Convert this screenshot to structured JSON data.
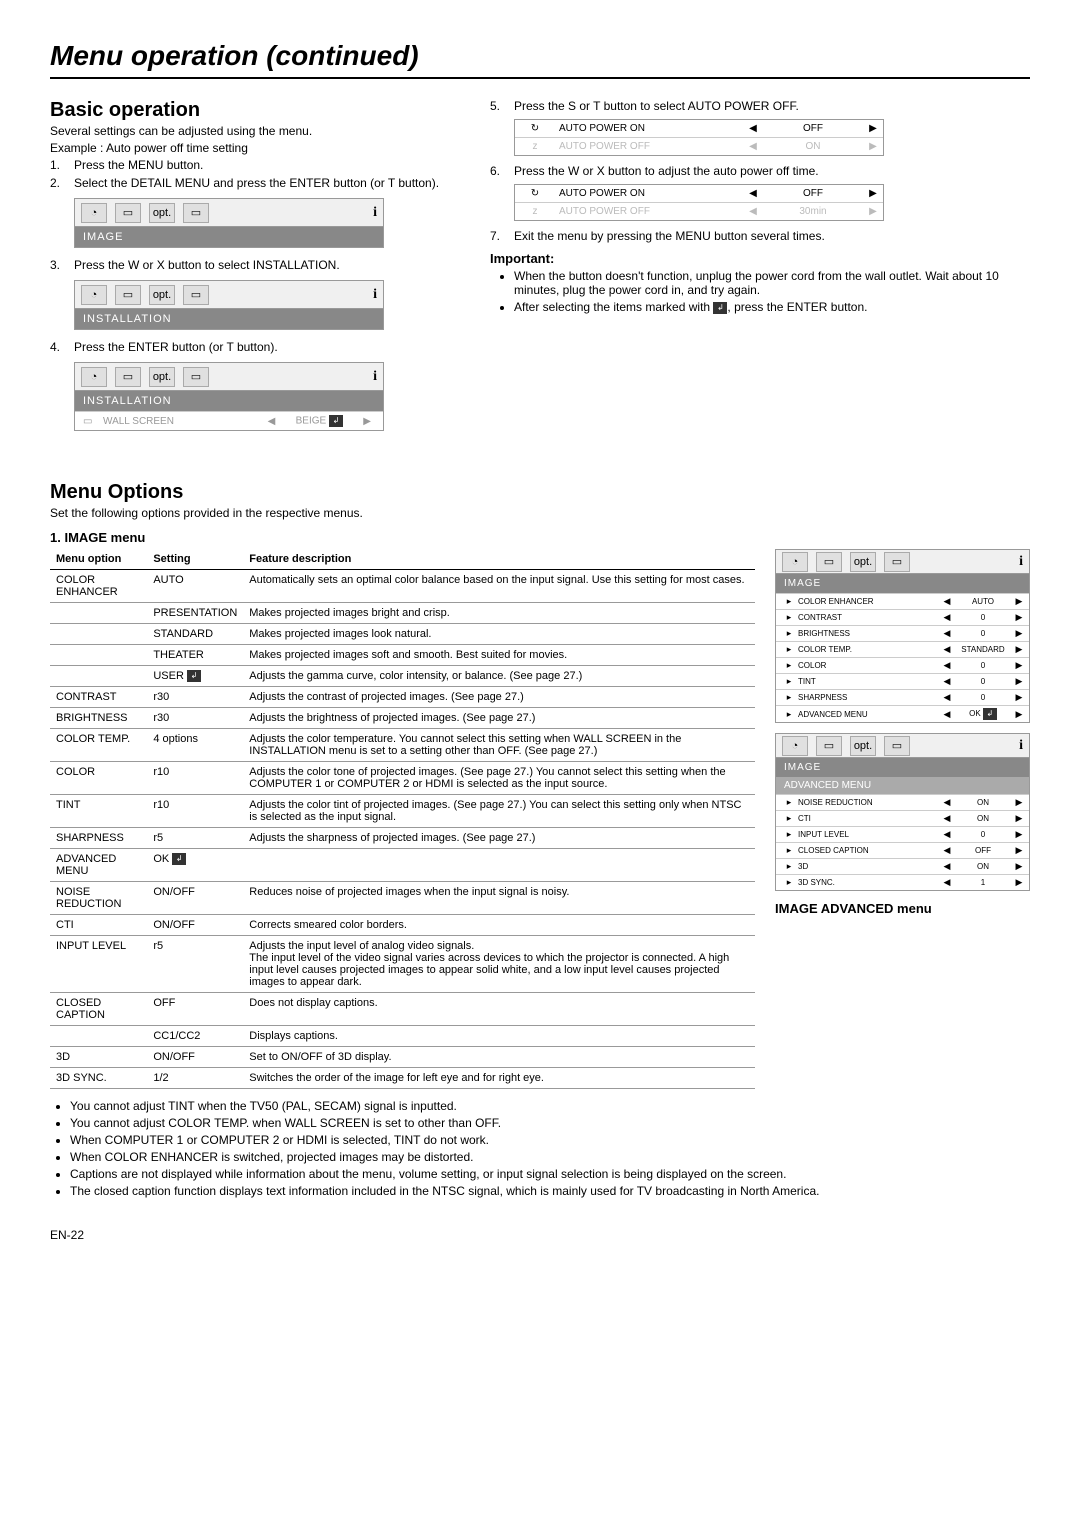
{
  "page_title": "Menu operation (continued)",
  "basic": {
    "heading": "Basic operation",
    "intro1": "Several settings can be adjusted using the menu.",
    "intro2": "Example : Auto power off time setting",
    "s1": "Press the MENU button.",
    "s2": "Select the DETAIL MENU and press the ENTER button  (or  T  button).",
    "s3": "Press the  W or  X button to select INSTALLATION.",
    "s4": "Press the ENTER button (or  T  button).",
    "img_label": "IMAGE",
    "inst_label": "INSTALLATION",
    "wall_screen": "WALL SCREEN",
    "beige": "BEIGE"
  },
  "right": {
    "s5": "Press the  S  or  T  button to select AUTO POWER OFF.",
    "s6": "Press the  W or  X button to adjust the auto power off time.",
    "s7": "Exit the menu by pressing the MENU button several times.",
    "ap_on": "AUTO POWER ON",
    "ap_off": "AUTO POWER OFF",
    "off": "OFF",
    "on": "ON",
    "thirty": "30min",
    "important": "Important:",
    "b1": "When the button doesn't function, unplug the power cord from the wall outlet. Wait about 10 minutes, plug the power cord in, and try again.",
    "b2_a": "After selecting the items marked with ",
    "b2_b": ", press the ENTER button."
  },
  "menu_options": {
    "heading": "Menu Options",
    "intro": "Set the following options provided in the respective menus.",
    "image_menu": "1. IMAGE menu",
    "th1": "Menu option",
    "th2": "Setting",
    "th3": "Feature description",
    "rows": [
      {
        "o": "COLOR ENHANCER",
        "s": "AUTO",
        "d": "Automatically sets an optimal color balance based on the input signal. Use this setting for most cases."
      },
      {
        "o": "",
        "s": "PRESENTATION",
        "d": "Makes projected images bright and crisp."
      },
      {
        "o": "",
        "s": "STANDARD",
        "d": "Makes projected images look natural."
      },
      {
        "o": "",
        "s": "THEATER",
        "d": "Makes projected images soft and smooth. Best suited for movies."
      },
      {
        "o": "",
        "s": "USER",
        "d": "Adjusts the gamma curve, color intensity, or balance. (See page 27.)"
      },
      {
        "o": "CONTRAST",
        "s": "r30",
        "d": "Adjusts the contrast of projected images. (See page 27.)"
      },
      {
        "o": "BRIGHTNESS",
        "s": "r30",
        "d": "Adjusts the brightness of projected images. (See page 27.)"
      },
      {
        "o": "COLOR TEMP.",
        "s": "4 options",
        "d": "Adjusts the color temperature. You cannot select this setting when WALL SCREEN in the INSTALLATION menu is set to a setting other than OFF. (See page 27.)"
      },
      {
        "o": "COLOR",
        "s": "r10",
        "d": "Adjusts the color tone of projected images. (See page 27.) You cannot select this setting when the COMPUTER 1 or COMPUTER 2 or HDMI is selected as the input source."
      },
      {
        "o": "TINT",
        "s": "r10",
        "d": "Adjusts the color tint of projected images. (See page 27.) You can select this setting only when NTSC is selected as the input signal."
      },
      {
        "o": "SHARPNESS",
        "s": "r5",
        "d": "Adjusts the sharpness of projected images. (See page 27.)"
      },
      {
        "o": "ADVANCED MENU",
        "s": "OK",
        "d": ""
      },
      {
        "o": "     NOISE REDUCTION",
        "s": "ON/OFF",
        "d": "Reduces noise of projected images when the input signal is noisy."
      },
      {
        "o": "     CTI",
        "s": "ON/OFF",
        "d": "Corrects smeared color borders."
      },
      {
        "o": "     INPUT LEVEL",
        "s": "r5",
        "d": "Adjusts the input level of analog video signals.\nThe input level of the video signal varies across devices to which the projector is connected. A high input level causes projected images to appear solid white, and a low input level causes projected images to appear dark."
      },
      {
        "o": "     CLOSED CAPTION",
        "s": "OFF",
        "d": "Does not display captions."
      },
      {
        "o": "",
        "s": "CC1/CC2",
        "d": "Displays captions."
      },
      {
        "o": "     3D",
        "s": "ON/OFF",
        "d": "Set to ON/OFF of 3D display."
      },
      {
        "o": "     3D SYNC.",
        "s": "1/2",
        "d": "Switches the order of the image for left eye and for right eye."
      }
    ],
    "side_image": {
      "label": "IMAGE",
      "items": [
        {
          "n": "COLOR ENHANCER",
          "v": "AUTO"
        },
        {
          "n": "CONTRAST",
          "v": "0"
        },
        {
          "n": "BRIGHTNESS",
          "v": "0"
        },
        {
          "n": "COLOR TEMP.",
          "v": "STANDARD"
        },
        {
          "n": "COLOR",
          "v": "0"
        },
        {
          "n": "TINT",
          "v": "0"
        },
        {
          "n": "SHARPNESS",
          "v": "0"
        },
        {
          "n": "ADVANCED MENU",
          "v": "OK"
        }
      ]
    },
    "side_adv": {
      "label": "IMAGE",
      "sub": "ADVANCED MENU",
      "items": [
        {
          "n": "NOISE REDUCTION",
          "v": "ON"
        },
        {
          "n": "CTI",
          "v": "ON"
        },
        {
          "n": "INPUT LEVEL",
          "v": "0"
        },
        {
          "n": "CLOSED CAPTION",
          "v": "OFF"
        },
        {
          "n": "3D",
          "v": "ON"
        },
        {
          "n": "3D SYNC.",
          "v": "1"
        }
      ]
    },
    "adv_title": "IMAGE ADVANCED menu",
    "notes": [
      "You cannot adjust TINT when the TV50 (PAL, SECAM) signal is inputted.",
      "You cannot adjust COLOR TEMP. when WALL SCREEN is set to other than OFF.",
      "When COMPUTER 1 or COMPUTER 2 or HDMI is selected, TINT do not work.",
      "When COLOR ENHANCER is switched, projected images may be distorted.",
      "Captions are not displayed while information about the menu, volume setting, or input signal selection is being displayed on the screen.",
      "The closed caption function displays text information included in the NTSC signal, which is mainly used for TV broadcasting in North America."
    ]
  },
  "footer": "EN-22"
}
